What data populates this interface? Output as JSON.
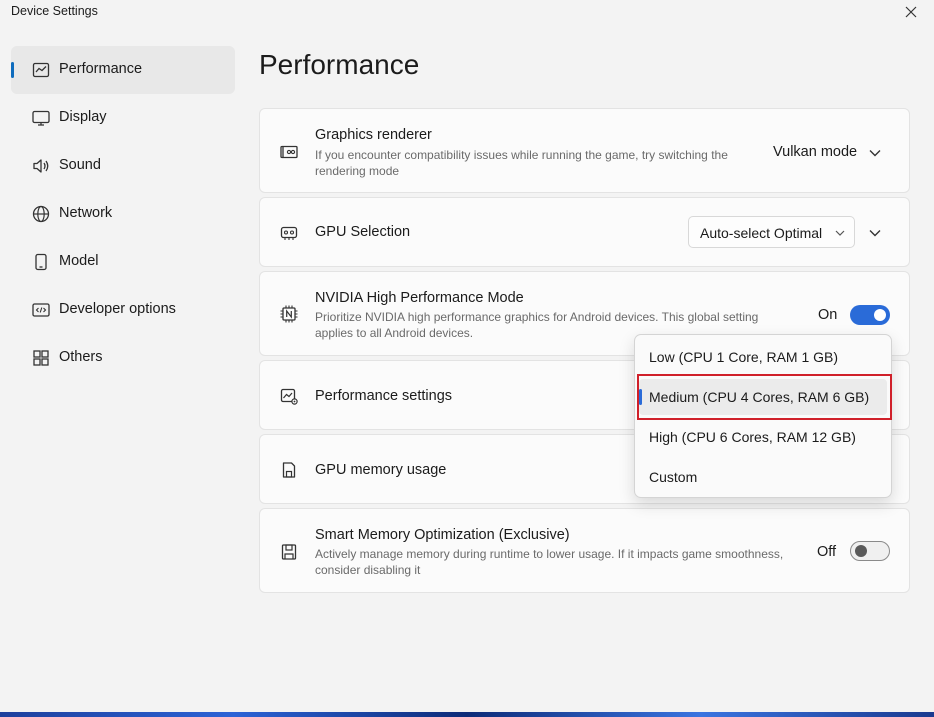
{
  "window": {
    "title": "Device Settings"
  },
  "sidebar": {
    "items": [
      {
        "label": "Performance",
        "icon": "chart-icon",
        "active": true
      },
      {
        "label": "Display",
        "icon": "monitor-icon"
      },
      {
        "label": "Sound",
        "icon": "speaker-icon"
      },
      {
        "label": "Network",
        "icon": "globe-icon"
      },
      {
        "label": "Model",
        "icon": "phone-icon"
      },
      {
        "label": "Developer options",
        "icon": "code-icon"
      },
      {
        "label": "Others",
        "icon": "grid-icon"
      }
    ]
  },
  "page": {
    "title": "Performance"
  },
  "settings": {
    "graphics_renderer": {
      "title": "Graphics renderer",
      "desc": "If you encounter compatibility issues while running the game, try switching the rendering mode",
      "value": "Vulkan mode"
    },
    "gpu_selection": {
      "title": "GPU Selection",
      "value": "Auto-select Optimal"
    },
    "nvidia": {
      "title": "NVIDIA High Performance Mode",
      "desc": "Prioritize NVIDIA high performance graphics for Android devices. This global setting applies to all Android devices.",
      "toggle_label": "On",
      "toggle_on": true
    },
    "performance_settings": {
      "title": "Performance settings"
    },
    "gpu_memory": {
      "title": "GPU memory usage"
    },
    "smart_memory": {
      "title": "Smart Memory Optimization (Exclusive)",
      "desc": "Actively manage memory during runtime to lower usage. If it impacts game smoothness, consider disabling it",
      "toggle_label": "Off",
      "toggle_on": false
    }
  },
  "performance_dropdown": {
    "options": [
      "Low (CPU 1 Core, RAM 1 GB)",
      "Medium (CPU 4 Cores, RAM 6 GB)",
      "High (CPU 6 Cores, RAM 12 GB)",
      "Custom"
    ],
    "selected": "Medium (CPU 4 Cores, RAM 6 GB)"
  },
  "colors": {
    "accent": "#2a6bd8",
    "highlight": "#d0202a"
  }
}
